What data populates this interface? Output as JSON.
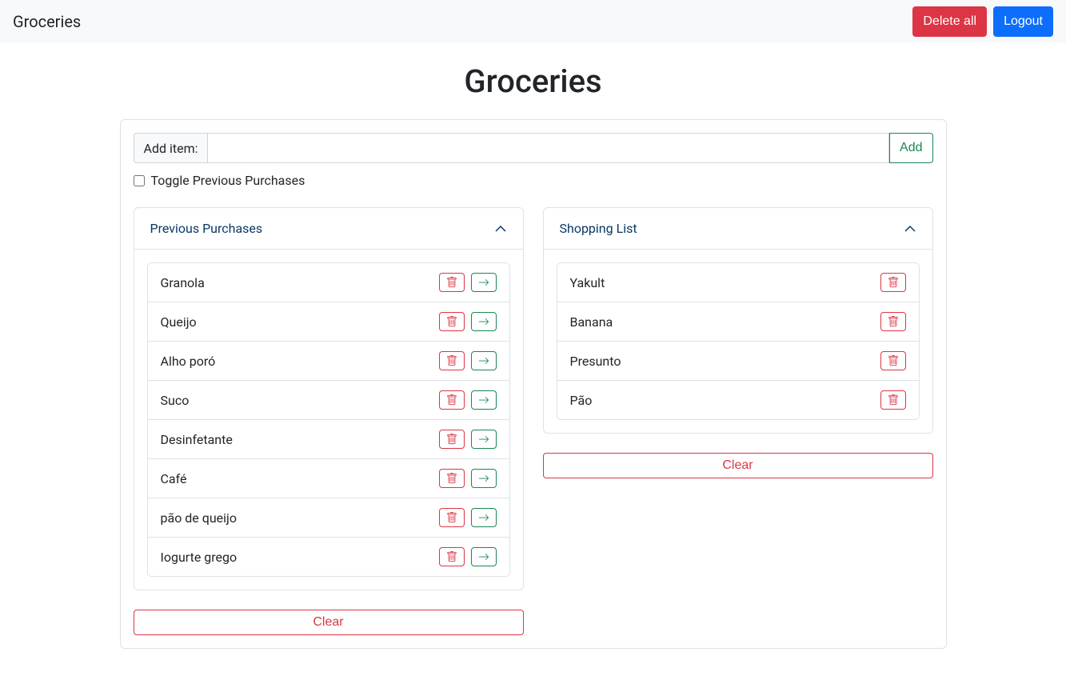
{
  "navbar": {
    "brand": "Groceries",
    "delete_all_label": "Delete all",
    "logout_label": "Logout"
  },
  "page": {
    "title": "Groceries"
  },
  "add_item": {
    "prefix": "Add item:",
    "value": "",
    "button_label": "Add"
  },
  "toggle": {
    "label": "Toggle Previous Purchases",
    "checked": false
  },
  "previous_purchases": {
    "header": "Previous Purchases",
    "items": [
      {
        "name": "Granola"
      },
      {
        "name": "Queijo"
      },
      {
        "name": "Alho poró"
      },
      {
        "name": "Suco"
      },
      {
        "name": "Desinfetante"
      },
      {
        "name": "Café"
      },
      {
        "name": "pão de queijo"
      },
      {
        "name": "Iogurte grego"
      }
    ],
    "clear_label": "Clear"
  },
  "shopping_list": {
    "header": "Shopping List",
    "items": [
      {
        "name": "Yakult"
      },
      {
        "name": "Banana"
      },
      {
        "name": "Presunto"
      },
      {
        "name": "Pão"
      }
    ],
    "clear_label": "Clear"
  }
}
